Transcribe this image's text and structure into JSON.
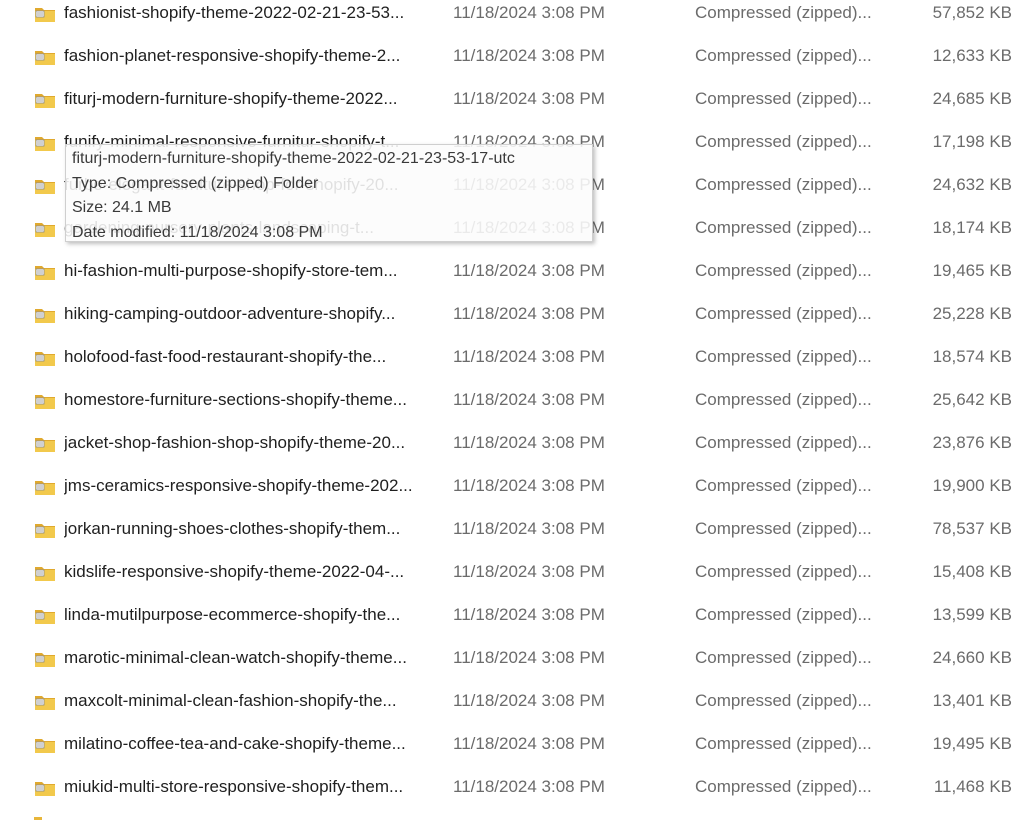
{
  "files": [
    {
      "name": "fashionist-shopify-theme-2022-02-21-23-53...",
      "date_modified": "11/18/2024 3:08 PM",
      "type": "Compressed (zipped)...",
      "size": "57,852 KB",
      "icon": "zip-folder-icon"
    },
    {
      "name": "fashion-planet-responsive-shopify-theme-2...",
      "date_modified": "11/18/2024 3:08 PM",
      "type": "Compressed (zipped)...",
      "size": "12,633 KB",
      "icon": "zip-folder-icon"
    },
    {
      "name": "fiturj-modern-furniture-shopify-theme-2022...",
      "date_modified": "11/18/2024 3:08 PM",
      "type": "Compressed (zipped)...",
      "size": "24,685 KB",
      "icon": "zip-folder-icon"
    },
    {
      "name": "funify-minimal-responsive-furnitur-shopify-t...",
      "date_modified": "11/18/2024 3:08 PM",
      "type": "Compressed (zipped)...",
      "size": "17,198 KB",
      "icon": "zip-folder-icon"
    },
    {
      "name": "furbe-elegant-furniture-shop-for-shopify-20...",
      "date_modified": "11/18/2024 3:08 PM",
      "type": "Compressed (zipped)...",
      "size": "24,632 KB",
      "icon": "zip-folder-icon"
    },
    {
      "name": "gardening-nursery-plants-landscaping-t...",
      "date_modified": "11/18/2024 3:08 PM",
      "type": "Compressed (zipped)...",
      "size": "18,174 KB",
      "icon": "zip-folder-icon"
    },
    {
      "name": "hi-fashion-multi-purpose-shopify-store-tem...",
      "date_modified": "11/18/2024 3:08 PM",
      "type": "Compressed (zipped)...",
      "size": "19,465 KB",
      "icon": "zip-folder-icon"
    },
    {
      "name": "hiking-camping-outdoor-adventure-shopify...",
      "date_modified": "11/18/2024 3:08 PM",
      "type": "Compressed (zipped)...",
      "size": "25,228 KB",
      "icon": "zip-folder-icon"
    },
    {
      "name": "holofood-fast-food-restaurant-shopify-the...",
      "date_modified": "11/18/2024 3:08 PM",
      "type": "Compressed (zipped)...",
      "size": "18,574 KB",
      "icon": "zip-folder-icon"
    },
    {
      "name": "homestore-furniture-sections-shopify-theme...",
      "date_modified": "11/18/2024 3:08 PM",
      "type": "Compressed (zipped)...",
      "size": "25,642 KB",
      "icon": "zip-folder-icon"
    },
    {
      "name": "jacket-shop-fashion-shop-shopify-theme-20...",
      "date_modified": "11/18/2024 3:08 PM",
      "type": "Compressed (zipped)...",
      "size": "23,876 KB",
      "icon": "zip-folder-icon"
    },
    {
      "name": "jms-ceramics-responsive-shopify-theme-202...",
      "date_modified": "11/18/2024 3:08 PM",
      "type": "Compressed (zipped)...",
      "size": "19,900 KB",
      "icon": "zip-folder-icon"
    },
    {
      "name": "jorkan-running-shoes-clothes-shopify-them...",
      "date_modified": "11/18/2024 3:08 PM",
      "type": "Compressed (zipped)...",
      "size": "78,537 KB",
      "icon": "zip-folder-icon"
    },
    {
      "name": "kidslife-responsive-shopify-theme-2022-04-...",
      "date_modified": "11/18/2024 3:08 PM",
      "type": "Compressed (zipped)...",
      "size": "15,408 KB",
      "icon": "zip-folder-icon"
    },
    {
      "name": "linda-mutilpurpose-ecommerce-shopify-the...",
      "date_modified": "11/18/2024 3:08 PM",
      "type": "Compressed (zipped)...",
      "size": "13,599 KB",
      "icon": "zip-folder-icon"
    },
    {
      "name": "marotic-minimal-clean-watch-shopify-theme...",
      "date_modified": "11/18/2024 3:08 PM",
      "type": "Compressed (zipped)...",
      "size": "24,660 KB",
      "icon": "zip-folder-icon"
    },
    {
      "name": "maxcolt-minimal-clean-fashion-shopify-the...",
      "date_modified": "11/18/2024 3:08 PM",
      "type": "Compressed (zipped)...",
      "size": "13,401 KB",
      "icon": "zip-folder-icon"
    },
    {
      "name": "milatino-coffee-tea-and-cake-shopify-theme...",
      "date_modified": "11/18/2024 3:08 PM",
      "type": "Compressed (zipped)...",
      "size": "19,495 KB",
      "icon": "zip-folder-icon"
    },
    {
      "name": "miukid-multi-store-responsive-shopify-them...",
      "date_modified": "11/18/2024 3:08 PM",
      "type": "Compressed (zipped)...",
      "size": "11,468 KB",
      "icon": "zip-folder-icon"
    }
  ],
  "tooltip": {
    "name": "fiturj-modern-furniture-shopify-theme-2022-02-21-23-53-17-utc",
    "type_line": "Type: Compressed (zipped) Folder",
    "size_line": "Size: 24.1 MB",
    "date_line": "Date modified: 11/18/2024 3:08 PM"
  },
  "colors": {
    "folder_yellow": "#f2c94c",
    "folder_dark": "#e0a92e",
    "zipper": "#8a8a8a",
    "secondary_text": "#6b6b6b"
  }
}
